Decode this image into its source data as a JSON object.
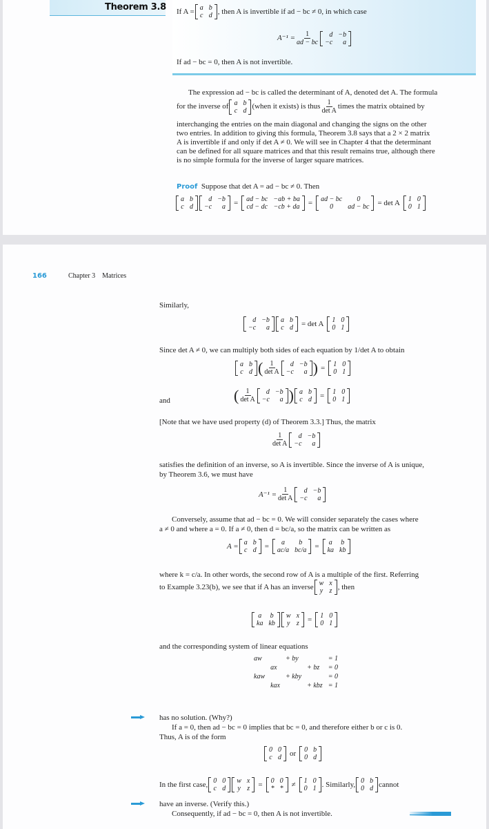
{
  "page1": {
    "theorem": {
      "label": "Theorem 3.8",
      "line1_pre": "If A =",
      "line1_post": ", then A is invertible if ad − bc ≠ 0, in which case",
      "matrix_A": [
        [
          "a",
          "b"
        ],
        [
          "c",
          "d"
        ]
      ],
      "inverse_lhs": "A⁻¹ =",
      "inverse_frac_num": "1",
      "inverse_frac_den": "ad − bc",
      "inverse_matrix": [
        [
          "d",
          "−b"
        ],
        [
          "−c",
          "a"
        ]
      ],
      "line3": "If ad − bc = 0, then A is not invertible."
    },
    "paragraph": {
      "line1": "The expression ad − bc is called the determinant of A, denoted det A. The formula",
      "line2_pre": "for the inverse of",
      "line2_mid": "(when it exists) is thus",
      "line2_frac_num": "1",
      "line2_frac_den": "det A",
      "line2_post": "times the matrix obtained by",
      "matrix": [
        [
          "a",
          "b"
        ],
        [
          "c",
          "d"
        ]
      ],
      "rest": [
        "interchanging the entries on the main diagonal and changing the signs on the other",
        "two entries. In addition to giving this formula, Theorem 3.8 says that a 2 × 2 matrix",
        "A is invertible if and only if det A ≠ 0. We will see in Chapter 4 that the determinant",
        "can be defined for all square matrices and that this result remains true, although there",
        "is no simple formula for the inverse of larger square matrices."
      ]
    },
    "proof": {
      "label": "Proof",
      "text": "Suppose that det A = ad − bc ≠ 0. Then",
      "m1": [
        [
          "a",
          "b"
        ],
        [
          "c",
          "d"
        ]
      ],
      "m2": [
        [
          "d",
          "−b"
        ],
        [
          "−c",
          "a"
        ]
      ],
      "m3": [
        [
          "ad − bc",
          "−ab + ba"
        ],
        [
          "cd − dc",
          "−cb + da"
        ]
      ],
      "m4": [
        [
          "ad − bc",
          "0"
        ],
        [
          "0",
          "ad − bc"
        ]
      ],
      "eq": "=",
      "det_label": "= det A",
      "identity": [
        [
          "1",
          "0"
        ],
        [
          "0",
          "1"
        ]
      ]
    }
  },
  "page2": {
    "page_number": "166",
    "running_head": "Chapter 3    Matrices",
    "similarly": "Similarly,",
    "sim_m1": [
      [
        "d",
        "−b"
      ],
      [
        "−c",
        "a"
      ]
    ],
    "sim_m2": [
      [
        "a",
        "b"
      ],
      [
        "c",
        "d"
      ]
    ],
    "det_label": "= det A",
    "identity": [
      [
        "1",
        "0"
      ],
      [
        "0",
        "1"
      ]
    ],
    "since_text": "Since det A ≠ 0, we can multiply both sides of each equation by 1/det A to obtain",
    "frac_num": "1",
    "frac_den": "det A",
    "and_label": "and",
    "note_text": "[Note that we have used property (d) of Theorem 3.3.] Thus, the matrix",
    "satisfies_lines": [
      "satisfies the definition of an inverse, so A is invertible. Since the inverse of A is unique,",
      "by Theorem 3.6, we must have"
    ],
    "inverse_lhs": "A⁻¹ =",
    "conversely_lines": [
      "Conversely, assume that ad − bc = 0. We will consider separately the cases where",
      "a ≠ 0 and where a = 0. If a ≠ 0, then d = bc/a, so the matrix can be written as"
    ],
    "A_eq": "A =",
    "A_m1": [
      [
        "a",
        "b"
      ],
      [
        "c",
        "d"
      ]
    ],
    "A_m2": [
      [
        "a",
        "b"
      ],
      [
        "ac/a",
        "bc/a"
      ]
    ],
    "A_m3": [
      [
        "a",
        "b"
      ],
      [
        "ka",
        "kb"
      ]
    ],
    "where_line": "where k = c/a. In other words, the second row of A is a multiple of the first. Referring",
    "example_pre": "to Example 3.23(b), we see that if A has an inverse",
    "example_post": ", then",
    "inv_wxyz": [
      [
        "w",
        "x"
      ],
      [
        "y",
        "z"
      ]
    ],
    "system_intro": "and the corresponding system of linear equations",
    "system": [
      [
        "aw",
        "",
        "+ by",
        "",
        "= 1"
      ],
      [
        "",
        "ax",
        "",
        "+ bz",
        "= 0"
      ],
      [
        "kaw",
        "",
        "+ kby",
        "",
        "= 0"
      ],
      [
        "",
        "kax",
        "",
        "+ kbz",
        "= 1"
      ]
    ],
    "no_solution": "has no solution. (Why?)",
    "if_a_zero": "If a = 0, then ad − bc = 0 implies that bc = 0, and therefore either b or c is 0.",
    "thus_form": "Thus, A is of the form",
    "form_m1": [
      [
        "0",
        "0"
      ],
      [
        "c",
        "d"
      ]
    ],
    "or_label": "or",
    "form_m2": [
      [
        "0",
        "b"
      ],
      [
        "0",
        "d"
      ]
    ],
    "first_case_pre": "In the first case,",
    "fc_m1": [
      [
        "0",
        "0"
      ],
      [
        "c",
        "d"
      ]
    ],
    "fc_m2": [
      [
        "w",
        "x"
      ],
      [
        "y",
        "z"
      ]
    ],
    "fc_m3": [
      [
        "0",
        "0"
      ],
      [
        "*",
        "*"
      ]
    ],
    "neq": "≠",
    "similarly2": ". Similarly,",
    "cannot": "cannot",
    "have_inverse": "have an inverse. (Verify this.)",
    "consequently": "Consequently, if ad − bc = 0, then A is not invertible."
  }
}
